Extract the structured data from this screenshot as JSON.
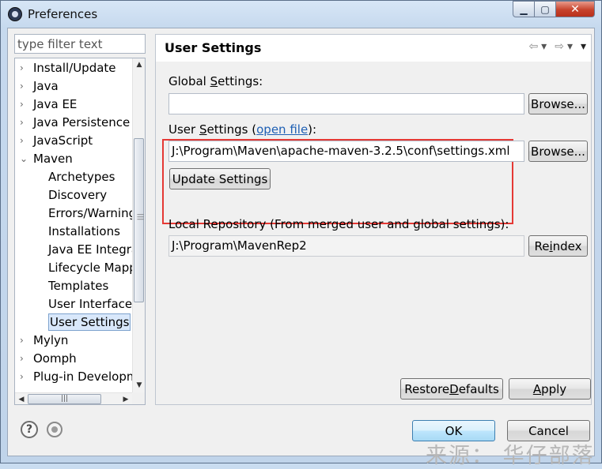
{
  "window": {
    "title": "Preferences",
    "minimize_glyph": "▁",
    "maximize_glyph": "▢",
    "close_glyph": "✕"
  },
  "sidebar": {
    "filter_placeholder": "type filter text",
    "items": [
      {
        "label": "Install/Update",
        "level": 0,
        "expandable": true
      },
      {
        "label": "Java",
        "level": 0,
        "expandable": true
      },
      {
        "label": "Java EE",
        "level": 0,
        "expandable": true
      },
      {
        "label": "Java Persistence",
        "level": 0,
        "expandable": true
      },
      {
        "label": "JavaScript",
        "level": 0,
        "expandable": true
      },
      {
        "label": "Maven",
        "level": 0,
        "expanded": true
      },
      {
        "label": "Archetypes",
        "level": 1
      },
      {
        "label": "Discovery",
        "level": 1
      },
      {
        "label": "Errors/Warnings",
        "level": 1
      },
      {
        "label": "Installations",
        "level": 1
      },
      {
        "label": "Java EE Integration",
        "level": 1
      },
      {
        "label": "Lifecycle Mappings",
        "level": 1
      },
      {
        "label": "Templates",
        "level": 1
      },
      {
        "label": "User Interface",
        "level": 1
      },
      {
        "label": "User Settings",
        "level": 1,
        "selected": true
      },
      {
        "label": "Mylyn",
        "level": 0,
        "expandable": true
      },
      {
        "label": "Oomph",
        "level": 0,
        "expandable": true
      },
      {
        "label": "Plug-in Development",
        "level": 0,
        "expandable": true
      }
    ],
    "collapsed_arrow": "›",
    "expanded_arrow": "⌄"
  },
  "page": {
    "title": "User Settings",
    "nav": {
      "back": "⇦",
      "dropdown": "▾",
      "forward": "⇨",
      "menu": "▾"
    },
    "global_settings": {
      "label_before": "Global ",
      "label_mnemonic": "S",
      "label_after": "ettings:",
      "value": "",
      "browse_label": "Browse..."
    },
    "user_settings": {
      "label_before": "User ",
      "label_mnemonic": "S",
      "label_after": "ettings (",
      "link": "open file",
      "label_end": "):",
      "value": "J:\\Program\\Maven\\apache-maven-3.2.5\\conf\\settings.xml",
      "browse_label": "Browse...",
      "update_label": "Update Settings"
    },
    "local_repository": {
      "label": "Local Repository (From merged user and global settings):",
      "value": "J:\\Program\\MavenRep2",
      "reindex_before": "Re",
      "reindex_mnemonic": "i",
      "reindex_after": "ndex"
    },
    "restore_before": "Restore ",
    "restore_mnemonic": "D",
    "restore_after": "efaults",
    "apply_mnemonic": "A",
    "apply_after": "pply"
  },
  "footer": {
    "help_glyph": "?",
    "ok_label": "OK",
    "cancel_label": "Cancel"
  },
  "watermark": "来源： 华仔部落",
  "colors": {
    "highlight_border": "#e53935",
    "link": "#1e5fb4",
    "selection": "#d9e8fb"
  }
}
